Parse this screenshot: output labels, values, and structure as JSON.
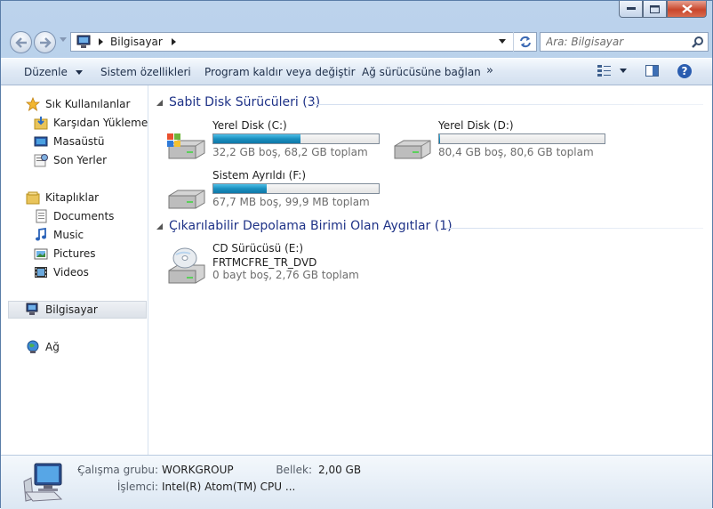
{
  "window": {
    "caption_buttons": [
      "minimize",
      "maximize",
      "close"
    ]
  },
  "nav": {
    "back_icon": "back-arrow-icon",
    "forward_icon": "forward-arrow-icon",
    "address": {
      "segment": "Bilgisayar"
    },
    "search_placeholder": "Ara: Bilgisayar"
  },
  "toolbar": {
    "organize": "Düzenle",
    "system_properties": "Sistem özellikleri",
    "uninstall": "Program kaldır veya değiştir",
    "map_drive": "Ağ sürücüsüne bağlan",
    "more": "»"
  },
  "sidebar": {
    "favorites": {
      "label": "Sık Kullanılanlar",
      "items": [
        "Karşıdan Yüklemeler",
        "Masaüstü",
        "Son Yerler"
      ]
    },
    "libraries": {
      "label": "Kitaplıklar",
      "items": [
        "Documents",
        "Music",
        "Pictures",
        "Videos"
      ]
    },
    "computer": "Bilgisayar",
    "network": "Ağ"
  },
  "groups": {
    "hard_disks": {
      "title": "Sabit Disk Sürücüleri (3)",
      "drives": [
        {
          "name": "Yerel Disk (C:)",
          "info": "32,2 GB boş, 68,2 GB toplam",
          "used_fraction": 0.528
        },
        {
          "name": "Yerel Disk (D:)",
          "info": "80,4 GB boş, 80,6 GB toplam",
          "used_fraction": 0.003
        },
        {
          "name": "Sistem Ayrıldı (F:)",
          "info": "67,7 MB boş, 99,9 MB toplam",
          "used_fraction": 0.322
        }
      ]
    },
    "removable": {
      "title": "Çıkarılabilir Depolama Birimi Olan Aygıtlar (1)",
      "drives": [
        {
          "name": "CD Sürücüsü (E:)",
          "label": "FRTMCFRE_TR_DVD",
          "info": "0 bayt boş, 2,76 GB toplam"
        }
      ]
    }
  },
  "details": {
    "dash": "-",
    "workgroup_label": "Çalışma grubu:",
    "workgroup": "WORKGROUP",
    "memory_label": "Bellek:",
    "memory": "2,00 GB",
    "cpu_label": "İşlemci:",
    "cpu": "Intel(R) Atom(TM) CPU ..."
  },
  "colors": {
    "accent_header": "#1e3287",
    "bar_fill": "#1a8fbf",
    "frame": "#bcd3ec"
  }
}
